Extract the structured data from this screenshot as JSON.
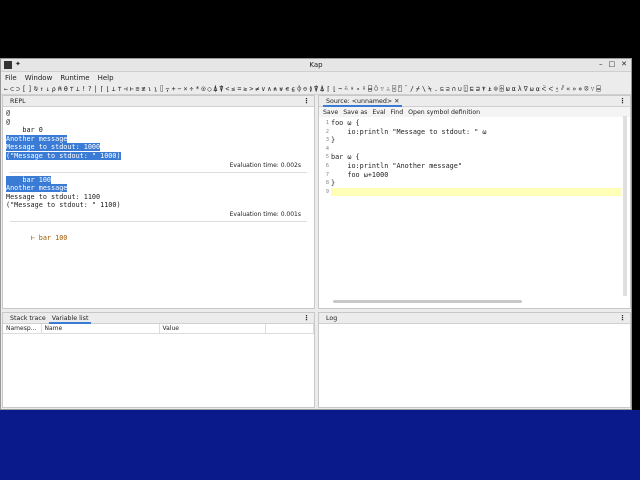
{
  "window": {
    "title": "Kap"
  },
  "menubar": [
    "File",
    "Window",
    "Runtime",
    "Help"
  ],
  "symbols": [
    "←",
    "⊂",
    "⊃",
    "[",
    "]",
    "⍉",
    "↑",
    "↓",
    "⍴",
    "⍝",
    "⍬",
    "⊤",
    "⊥",
    "!",
    "?",
    "|",
    "⌈",
    "⌊",
    "⊥",
    "⊤",
    "⊣",
    "⊢",
    "≡",
    "≢",
    "⍳",
    "⍸",
    "⌷",
    "⍪",
    "+",
    "−",
    "×",
    "÷",
    "*",
    "⍟",
    "○",
    "⍋",
    "⍒",
    "<",
    "≤",
    "=",
    "≥",
    ">",
    "≠",
    "∨",
    "∧",
    "⍲",
    "⍱",
    "∊",
    "⍷",
    "⌽",
    "⊖",
    "≬",
    "⍒",
    "⍋",
    "⌈",
    "⌊",
    "~",
    "⍨",
    "⍣",
    "∘",
    "⍤",
    "⌸",
    "⍥",
    "∵",
    "∴",
    "⌻",
    "⍞",
    "¨",
    "/",
    "⌿",
    "\\",
    "⍀",
    ".",
    "⊆",
    "⊇",
    "∩",
    "∪",
    "⍠",
    "⊑",
    "⊒",
    "⍕",
    "⍎",
    "⌾",
    "⌹",
    "ω",
    "α",
    "λ",
    "∇",
    "⍵",
    "⍺",
    "ᑈ",
    "ᐸ",
    "⍛",
    "⫽",
    "«",
    "»",
    "⋄",
    "⦻",
    "∵",
    "⌸"
  ],
  "repl": {
    "tab": "REPL",
    "blocks": [
      {
        "lines": [
          {
            "text": "@",
            "hl": false
          },
          {
            "text": "@",
            "hl": false
          },
          {
            "text": "    bar 0",
            "hl": false,
            "prompt": true
          },
          {
            "text": "Another message",
            "hl": true
          },
          {
            "text": "Message to stdout: 1000",
            "hl": true
          },
          {
            "text": "(\"Message to stdout: \" 1000)",
            "hl": true
          }
        ],
        "time": "Evaluation time: 0.002s"
      },
      {
        "lines": [
          {
            "text": "    bar 100",
            "hl": true,
            "prompt": true
          },
          {
            "text": "Another message",
            "hl": true
          },
          {
            "text": "Message to stdout: 1100",
            "hl": false
          },
          {
            "text": "(\"Message to stdout: \" 1100)",
            "hl": false
          }
        ],
        "time": "Evaluation time: 0.001s"
      }
    ],
    "input": "⊢ bar 100"
  },
  "source": {
    "tab": "Source: <unnamed>",
    "toolbar": [
      "Save",
      "Save as",
      "Eval",
      "Find",
      "Open symbol definition"
    ],
    "lines": [
      "foo ⍵ {",
      "    io:println \"Message to stdout: \" ⍵",
      "}",
      "",
      "bar ⍵ {",
      "    io:println \"Another message\"",
      "    foo ⍵+1000",
      "}",
      ""
    ],
    "current_line": 9
  },
  "bottom_left": {
    "tabs": [
      "Stack trace",
      "Variable list"
    ],
    "active_tab": 1,
    "columns": [
      "Namesp...",
      "Name",
      "Value"
    ]
  },
  "log": {
    "tab": "Log"
  }
}
